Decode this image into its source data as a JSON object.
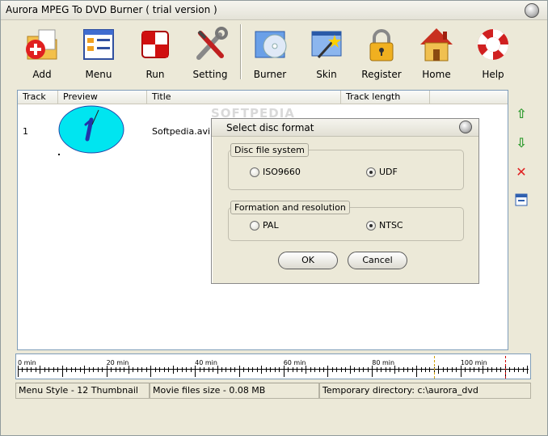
{
  "window": {
    "title": "Aurora MPEG To DVD Burner  ( trial version )"
  },
  "toolbar": {
    "buttons": [
      {
        "label": "Add"
      },
      {
        "label": "Menu"
      },
      {
        "label": "Run"
      },
      {
        "label": "Setting"
      },
      {
        "label": "Burner"
      },
      {
        "label": "Skin"
      },
      {
        "label": "Register"
      },
      {
        "label": "Home"
      },
      {
        "label": "Help"
      }
    ]
  },
  "tracklist": {
    "columns": [
      "Track",
      "Preview",
      "Title",
      "Track length"
    ],
    "rows": [
      {
        "track": "1",
        "title": "Softpedia.avi",
        "length": ""
      }
    ]
  },
  "watermark": "SOFTPEDIA",
  "dialog": {
    "title": "Select disc format",
    "disc_fs": {
      "legend": "Disc file system",
      "options": [
        "ISO9660",
        "UDF"
      ],
      "selected": "UDF"
    },
    "formation": {
      "legend": "Formation and resolution",
      "options": [
        "PAL",
        "NTSC"
      ],
      "selected": "NTSC"
    },
    "ok_label": "OK",
    "cancel_label": "Cancel"
  },
  "ruler": {
    "labels": [
      "0 min",
      "20 min",
      "40 min",
      "60 min",
      "80 min",
      "100 min"
    ],
    "unit_max": 115,
    "markers": [
      {
        "min": 94,
        "color": "#d0a000"
      },
      {
        "min": 110,
        "color": "#d00000"
      }
    ]
  },
  "statusbar": {
    "menu_style": "Menu Style - 12 Thumbnail",
    "files_size": "Movie files size - 0.08 MB",
    "temp_dir": "Temporary directory: c:\\aurora_dvd"
  },
  "colors": {
    "preview_fill": "#00e5f0",
    "move_up": "#2e9b2e",
    "delete": "#e02020"
  }
}
